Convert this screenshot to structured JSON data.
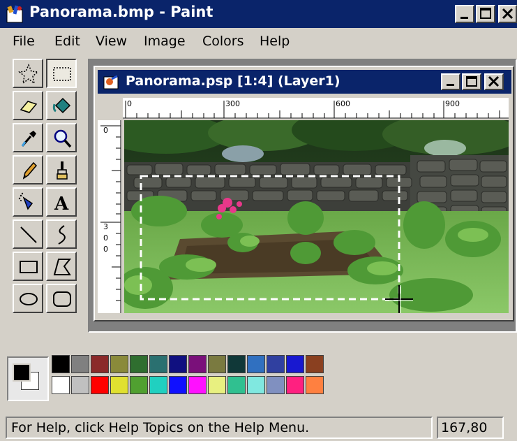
{
  "window": {
    "title": "Panorama.bmp - Paint"
  },
  "menu": [
    "File",
    "Edit",
    "View",
    "Image",
    "Colors",
    "Help"
  ],
  "tools": [
    {
      "icon": "free-form-select-icon",
      "name": "free-form-select"
    },
    {
      "icon": "rect-select-icon",
      "name": "select",
      "pressed": true
    },
    {
      "icon": "eraser-icon",
      "name": "eraser"
    },
    {
      "icon": "fill-bucket-icon",
      "name": "fill-with-color"
    },
    {
      "icon": "eyedropper-icon",
      "name": "pick-color"
    },
    {
      "icon": "magnifier-icon",
      "name": "magnifier"
    },
    {
      "icon": "pencil-icon",
      "name": "pencil"
    },
    {
      "icon": "brush-icon",
      "name": "brush"
    },
    {
      "icon": "airbrush-icon",
      "name": "airbrush"
    },
    {
      "icon": "text-icon",
      "name": "text"
    },
    {
      "icon": "line-icon",
      "name": "line"
    },
    {
      "icon": "curve-icon",
      "name": "curve"
    },
    {
      "icon": "rectangle-icon",
      "name": "rectangle"
    },
    {
      "icon": "polygon-icon",
      "name": "polygon"
    },
    {
      "icon": "ellipse-icon",
      "name": "ellipse"
    },
    {
      "icon": "rounded-rectangle-icon",
      "name": "rounded-rectangle"
    }
  ],
  "document": {
    "title": "Panorama.psp [1:4] (Layer1)",
    "ruler_h_labels": [
      "0",
      "300",
      "600",
      "900"
    ],
    "ruler_v_labels": [
      "0",
      "3",
      "0",
      "0"
    ]
  },
  "palette": {
    "foreground": "#000000",
    "background": "#ffffff",
    "row1": [
      "#000000",
      "#808080",
      "#8b2a2a",
      "#8a8a3a",
      "#2f6e2f",
      "#2a7070",
      "#101080",
      "#7a107a",
      "#7a7a40",
      "#103838",
      "#3070c0",
      "#3040a0",
      "#1818d0",
      "#8a4020"
    ],
    "row2": [
      "#ffffff",
      "#c0c0c0",
      "#ff0000",
      "#e0e030",
      "#50a030",
      "#20d0c0",
      "#1010ff",
      "#ff10ff",
      "#e8f080",
      "#30c090",
      "#80e8e0",
      "#8090c0",
      "#ff2080",
      "#ff8040"
    ]
  },
  "status": {
    "help_text": "For Help, click Help Topics on the Help Menu.",
    "coordinates": "167,80"
  }
}
